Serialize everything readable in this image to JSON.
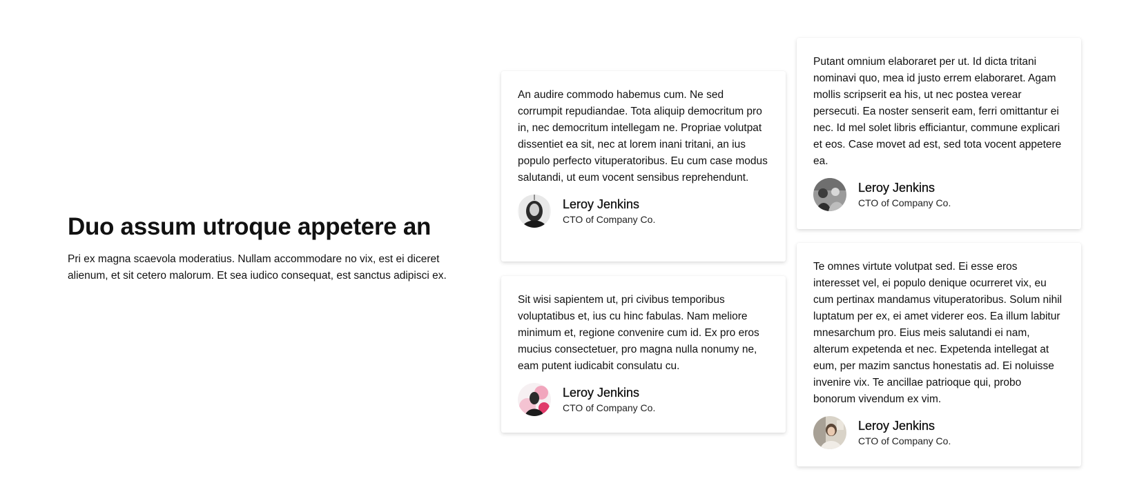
{
  "intro": {
    "heading": "Duo assum utroque appetere an",
    "text": "Pri ex magna scaevola moderatius. Nullam accommodare no vix, est ei diceret alienum, et sit cetero malorum. Et sea iudico consequat, est sanctus adipisci ex."
  },
  "testimonials": [
    {
      "quote": "An audire commodo habemus cum. Ne sed corrumpit repudiandae. Tota aliquip democritum pro in, nec democritum intellegam ne. Propriae volutpat dissentiet ea sit, nec at lorem inani tritani, an ius populo perfecto vituperatoribus. Eu cum case modus salutandi, ut eum vocent sensibus reprehendunt.",
      "name": "Leroy Jenkins",
      "role": "CTO of Company Co.",
      "avatar": "person-photo-icon"
    },
    {
      "quote": "Sit wisi sapientem ut, pri civibus temporibus voluptatibus et, ius cu hinc fabulas. Nam meliore minimum et, regione convenire cum id. Ex pro eros mucius consectetuer, pro magna nulla nonumy ne, eam putent iudicabit consulatu cu.",
      "name": "Leroy Jenkins",
      "role": "CTO of Company Co.",
      "avatar": "person-photo-icon"
    },
    {
      "quote": "Putant omnium elaboraret per ut. Id dicta tritani nominavi quo, mea id justo errem elaboraret. Agam mollis scripserit ea his, ut nec postea verear persecuti. Ea noster senserit eam, ferri omittantur ei nec. Id mel solet libris efficiantur, commune explicari et eos. Case movet ad est, sed tota vocent appetere ea.",
      "name": "Leroy Jenkins",
      "role": "CTO of Company Co.",
      "avatar": "person-photo-icon"
    },
    {
      "quote": "Te omnes virtute volutpat sed. Ei esse eros interesset vel, ei populo denique ocurreret vix, eu cum pertinax mandamus vituperatoribus. Solum nihil luptatum per ex, ei amet viderer eos. Ea illum labitur mnesarchum pro. Eius meis salutandi ei nam, alterum expetenda et nec. Expetenda intellegat at eum, per mazim sanctus honestatis ad. Ei noluisse invenire vix. Te ancillae patrioque qui, probo bonorum vivendum ex vim.",
      "name": "Leroy Jenkins",
      "role": "CTO of Company Co.",
      "avatar": "person-photo-icon"
    }
  ]
}
